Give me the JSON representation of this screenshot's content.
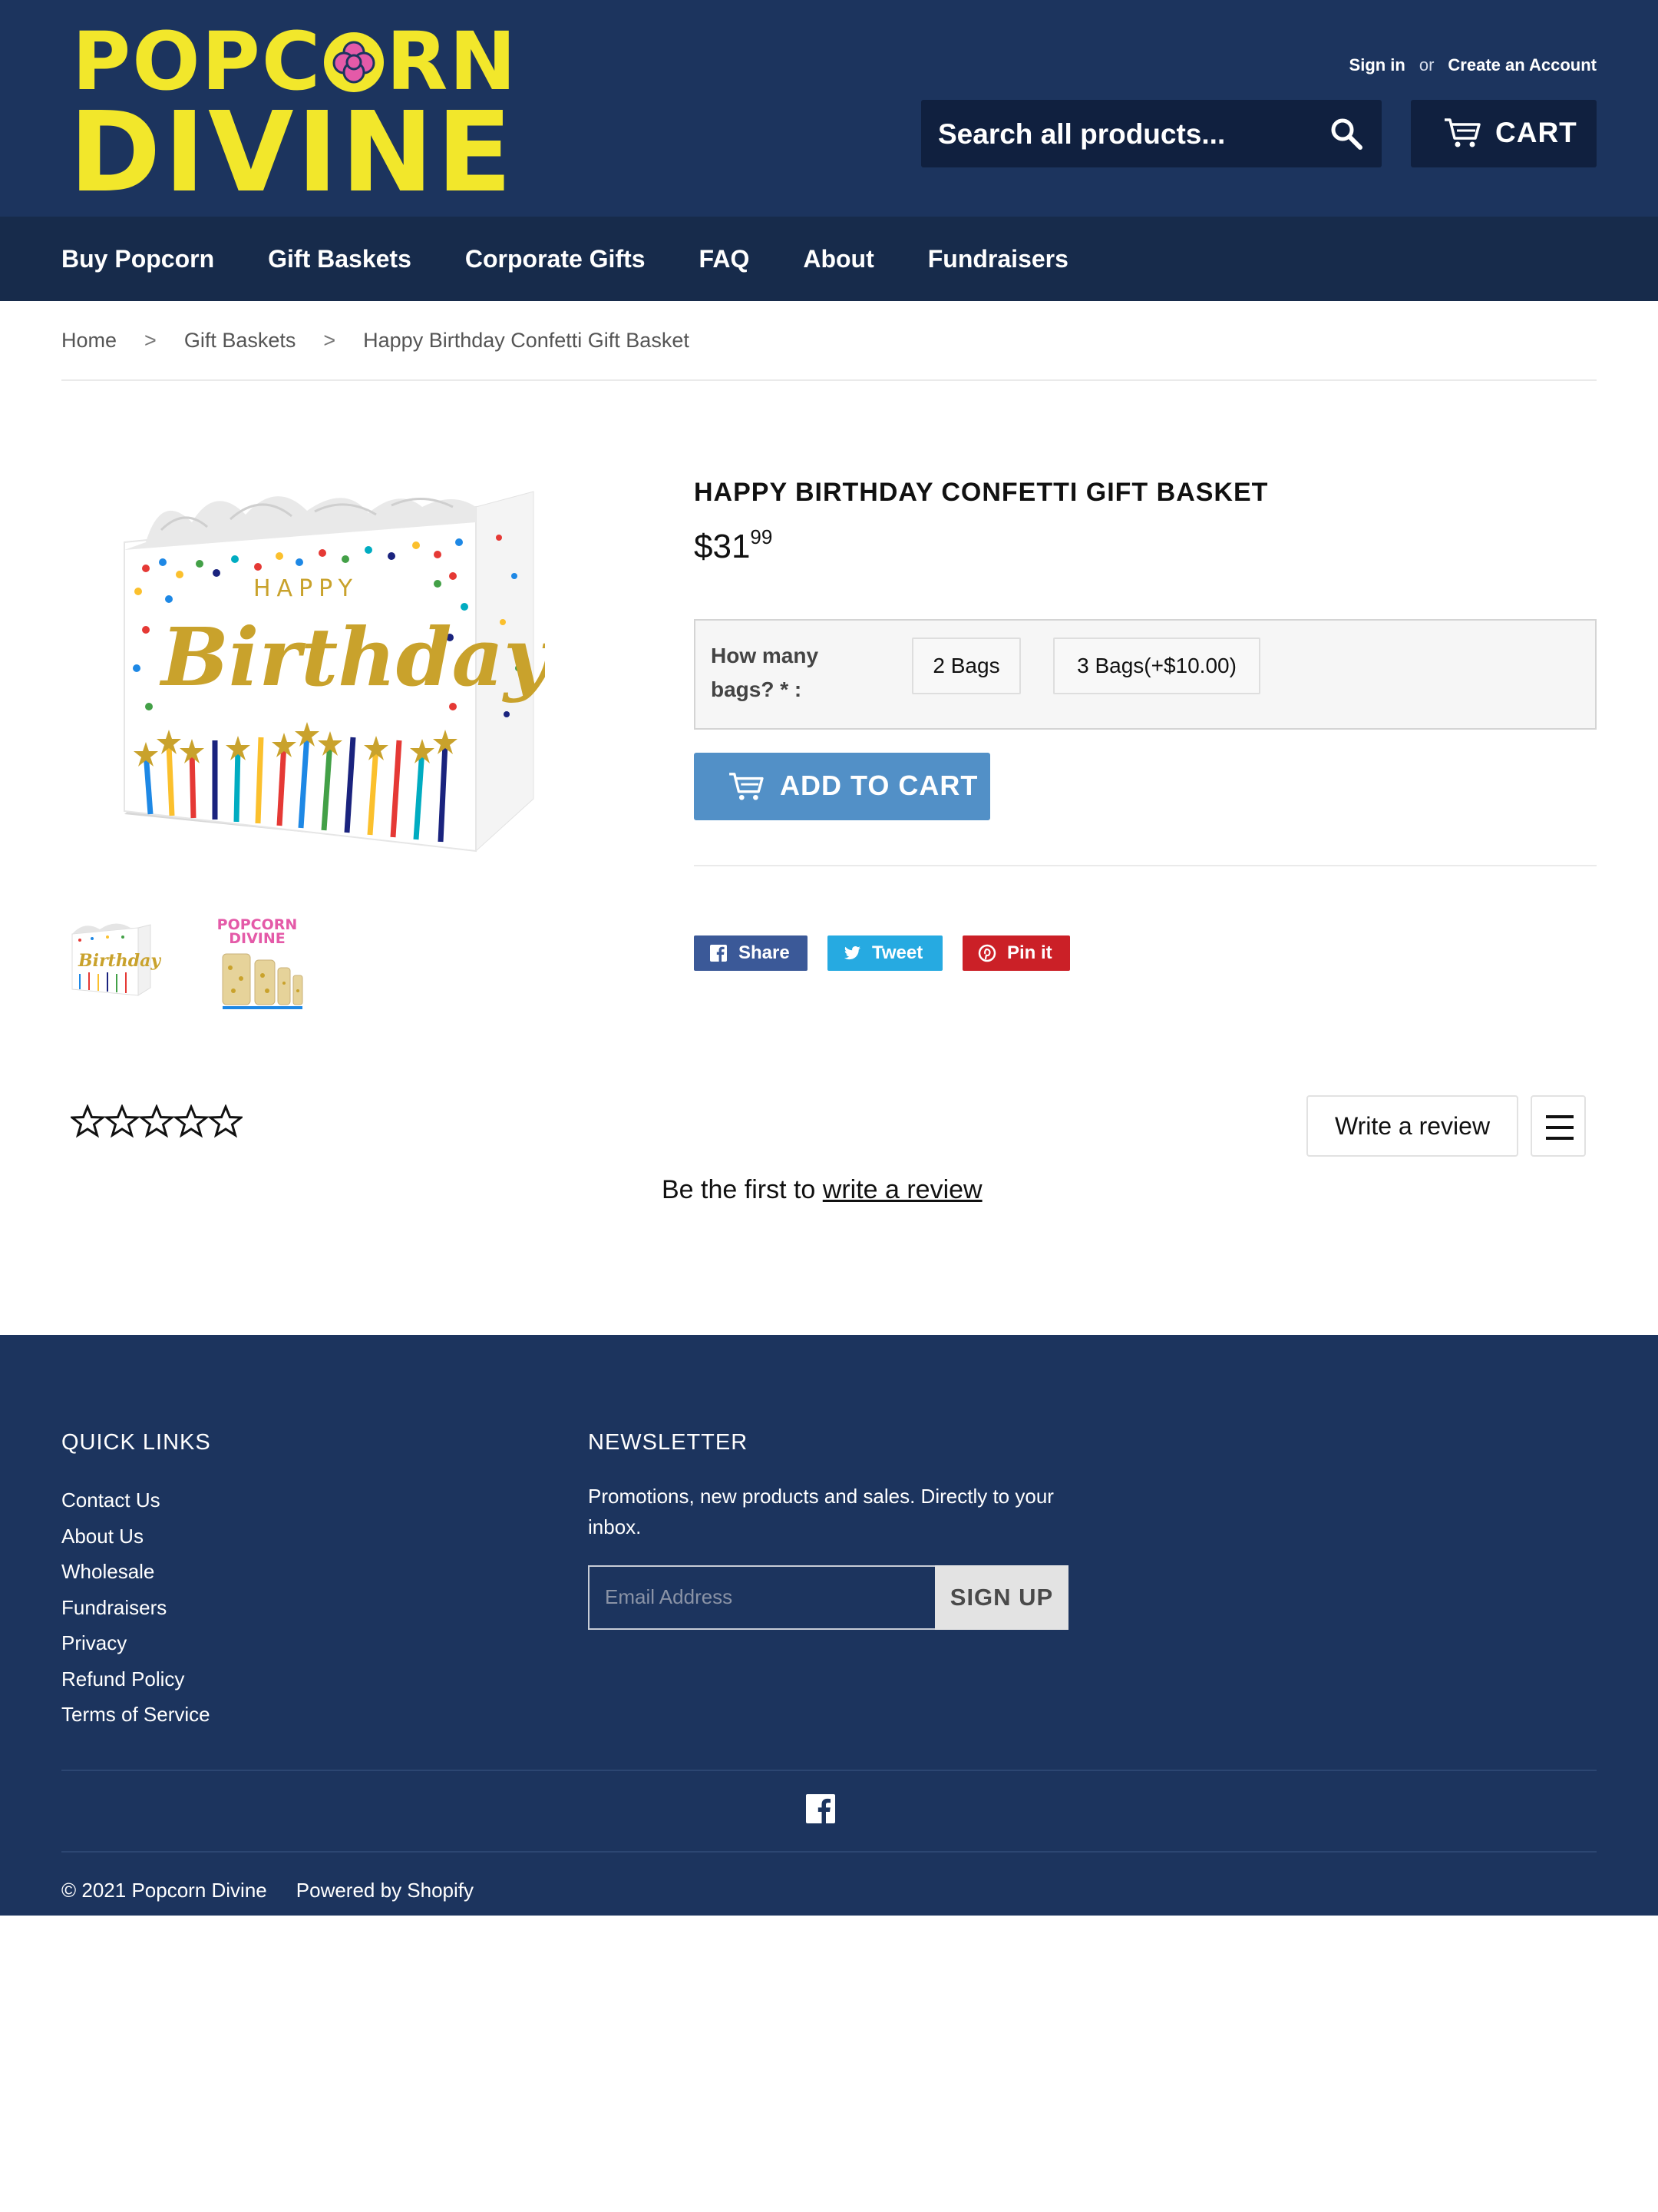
{
  "brand": {
    "logo_line1_a": "POPC",
    "logo_line1_b": "RN",
    "logo_line2": "DIVINE",
    "logo_color": "#f2e72b",
    "flower_color": "#e45aa8"
  },
  "header": {
    "sign_in": "Sign in",
    "or": "or",
    "create_account": "Create an Account",
    "search_placeholder": "Search all products...",
    "cart_label": "CART",
    "bg_color": "#1c345e"
  },
  "nav": {
    "items": [
      "Buy Popcorn",
      "Gift Baskets",
      "Corporate Gifts",
      "FAQ",
      "About",
      "Fundraisers"
    ]
  },
  "breadcrumb": {
    "home": "Home",
    "category": "Gift Baskets",
    "current": "Happy Birthday Confetti Gift Basket",
    "separator": ">"
  },
  "product": {
    "title": "HAPPY BIRTHDAY CONFETTI GIFT BASKET",
    "price_main": "$31",
    "price_cents": "99",
    "image_text_happy": "HAPPY",
    "image_text_birthday": "Birthday",
    "thumb2_brand_line1": "POPCORN",
    "thumb2_brand_line2": "DIVINE",
    "option_label": "How many bags? * :",
    "options": [
      "2 Bags",
      "3 Bags(+$10.00)"
    ],
    "add_to_cart": "ADD TO CART",
    "button_color": "#5290c7"
  },
  "share": {
    "facebook": "Share",
    "twitter": "Tweet",
    "pinterest": "Pin it",
    "facebook_color": "#3b5998",
    "twitter_color": "#26aae1",
    "pinterest_color": "#cb2027"
  },
  "reviews": {
    "rating_stars": 0,
    "write_review_button": "Write a review",
    "first_text": "Be the first to ",
    "first_link": "write a review"
  },
  "footer": {
    "quick_links_title": "QUICK LINKS",
    "quick_links": [
      "Contact Us",
      "About Us",
      "Wholesale",
      "Fundraisers",
      "Privacy",
      "Refund Policy",
      "Terms of Service"
    ],
    "newsletter_title": "NEWSLETTER",
    "newsletter_text": "Promotions, new products and sales. Directly to your inbox.",
    "email_placeholder": "Email Address",
    "signup_button": "SIGN UP",
    "copyright": "© 2021 Popcorn Divine",
    "powered_by": "Powered by Shopify"
  }
}
